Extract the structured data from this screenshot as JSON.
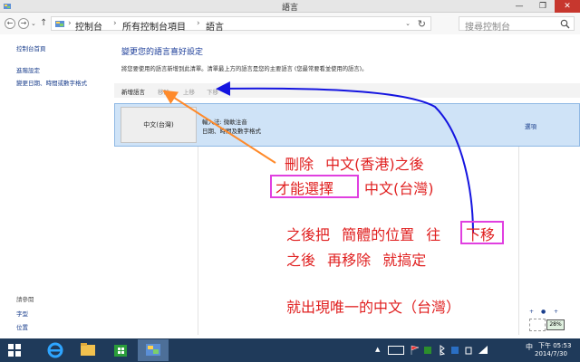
{
  "window": {
    "title": "語言",
    "min_glyph": "—",
    "max_glyph": "❐",
    "close_glyph": "✕"
  },
  "nav": {
    "back_glyph": "←",
    "forward_glyph": "→",
    "dropdown_glyph": "⌄",
    "up_glyph": "↑"
  },
  "breadcrumb": {
    "items": [
      "控制台",
      "所有控制台項目",
      "語言"
    ],
    "separator": "›",
    "dropdown_glyph": "⌄",
    "refresh_glyph": "↻"
  },
  "search": {
    "placeholder": "搜尋控制台"
  },
  "sidebar": {
    "links": [
      "控制台首頁",
      "進階設定",
      "變更日期、時間或數字格式"
    ],
    "see_also_heading": "請參閱",
    "see_also": [
      "字型",
      "位置"
    ]
  },
  "main": {
    "title": "變更您的語言喜好設定",
    "description": "將您要使用的語言新增到此清單。清單最上方的語言是您的主要語言 (您最常要看並使用的語言)。",
    "toolbar": {
      "add": "新增語言",
      "remove": "移除",
      "move_up": "上移",
      "move_down": "下移"
    },
    "language": {
      "name": "中文(台灣)",
      "input_method": "輸入法: 微軟注音",
      "formats": "日期、時間及數字格式",
      "options_link": "選項"
    }
  },
  "annotation": {
    "line1_a": "刪除",
    "line1_b": "中文(香港)之後",
    "line2_boxed": "才能選擇",
    "line2_rest": "中文(台灣)",
    "line3_a": "之後把",
    "line3_b": "簡體的位置",
    "line3_c": "往",
    "line3_boxed": "下移",
    "line4_a": "之後",
    "line4_b": "再移除",
    "line4_c": "就搞定",
    "line5": "就出現唯一的中文（台灣）",
    "text_color": "#e02020",
    "box_color": "#e040e0",
    "arrow_orange": "#ff8a2a",
    "arrow_blue": "#1414e0"
  },
  "widgets": {
    "percent": "28%",
    "plus": "+",
    "dot": "●"
  },
  "taskbar": {
    "tray_up": "▲",
    "ime_mode": "中",
    "time": "下午 05:53",
    "date": "2014/7/30"
  }
}
